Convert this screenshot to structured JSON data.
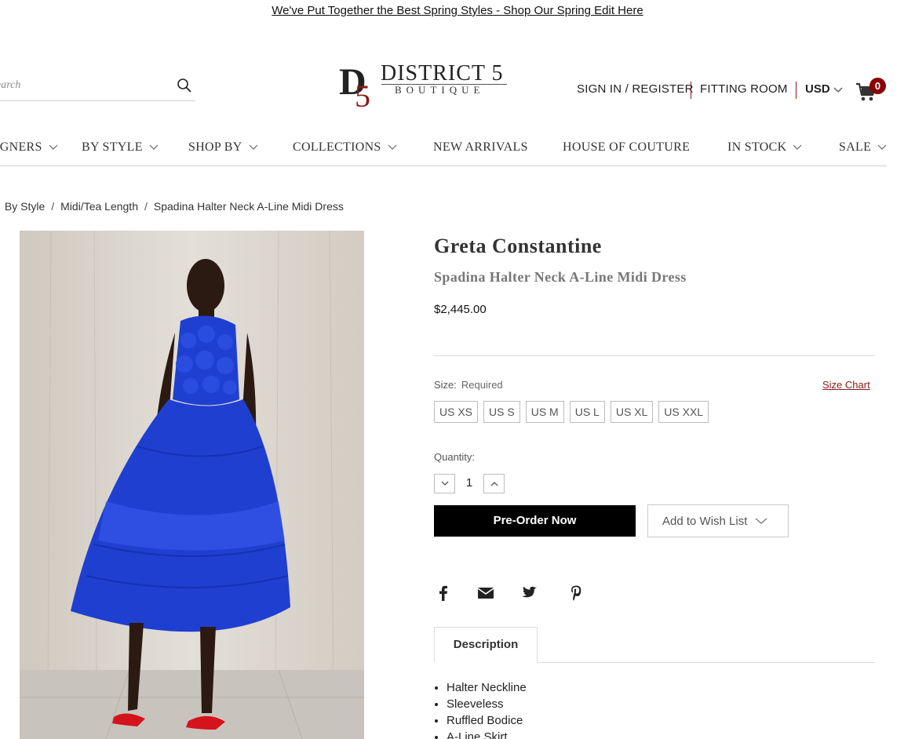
{
  "promo": {
    "text": "We've Put Together the Best Spring Styles - Shop Our Spring Edit Here"
  },
  "search": {
    "placeholder": "Search"
  },
  "logo": {
    "brand_line": "DISTRICT 5",
    "sub_line": "BOUTIQUE",
    "monogram": "D5"
  },
  "header": {
    "sign_in": "SIGN IN / REGISTER",
    "fitting_room": "FITTING ROOM",
    "currency": "USD",
    "cart_count": "0"
  },
  "nav": {
    "items": [
      {
        "label": "DESIGNERS"
      },
      {
        "label": "BY STYLE"
      },
      {
        "label": "SHOP BY"
      },
      {
        "label": "COLLECTIONS"
      },
      {
        "label": "NEW ARRIVALS"
      },
      {
        "label": "HOUSE OF COUTURE"
      },
      {
        "label": "IN STOCK"
      },
      {
        "label": "SALE"
      }
    ]
  },
  "breadcrumb": {
    "items": [
      "By Style",
      "Midi/Tea Length",
      "Spadina Halter Neck A-Line Midi Dress"
    ]
  },
  "product": {
    "brand": "Greta Constantine",
    "title": "Spadina Halter Neck A-Line Midi Dress",
    "price": "$2,445.00",
    "size_label": "Size:",
    "size_required": "Required",
    "size_chart": "Size Chart",
    "sizes": [
      "US XS",
      "US S",
      "US M",
      "US L",
      "US XL",
      "US XXL"
    ],
    "quantity_label": "Quantity:",
    "quantity": "1",
    "preorder_label": "Pre-Order Now",
    "wishlist_label": "Add to Wish List"
  },
  "share": {
    "icons": [
      "facebook-icon",
      "email-icon",
      "twitter-icon",
      "pinterest-icon"
    ]
  },
  "tabs": {
    "description_label": "Description"
  },
  "description": {
    "bullets": [
      "Halter Neckline",
      "Sleeveless",
      "Ruffled Bodice",
      "A-Line Skirt"
    ]
  },
  "colors": {
    "accent": "#8b1a1a",
    "cart_badge": "#8b0000",
    "primary_button": "#000000",
    "dress": "#1f3fd0"
  }
}
